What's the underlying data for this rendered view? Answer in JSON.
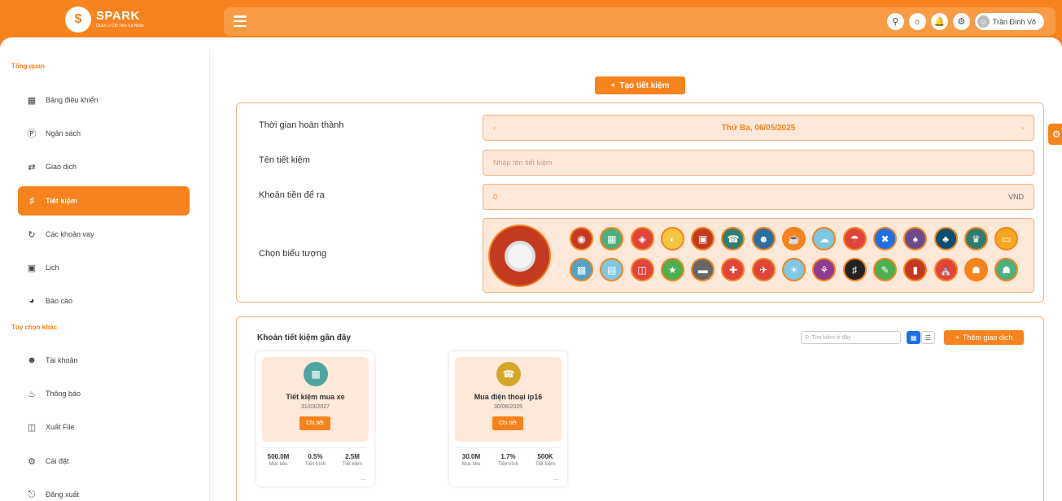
{
  "brand": {
    "name": "SPARK",
    "tagline": "Quản Lí Chi Tiêu Cá Nhân",
    "logo_symbol": "$"
  },
  "header": {
    "icons": [
      "search-icon",
      "sun-icon",
      "bell-icon",
      "settings-icon"
    ],
    "user_name": "Trần Đình Võ"
  },
  "sidebar": {
    "section_overview": "Tổng quan",
    "section_other": "Tùy chọn khác",
    "items": [
      {
        "label": "Bảng điều khiển",
        "icon": "dashboard-icon"
      },
      {
        "label": "Ngân sách",
        "icon": "dollar-icon"
      },
      {
        "label": "Giao dịch",
        "icon": "transfer-icon"
      },
      {
        "label": "Tiết kiệm",
        "icon": "piggy-icon"
      },
      {
        "label": "Các khoản vay",
        "icon": "loan-icon"
      },
      {
        "label": "Lịch",
        "icon": "calendar-icon"
      },
      {
        "label": "Báo cáo",
        "icon": "report-icon"
      }
    ],
    "other_items": [
      {
        "label": "Tài khoản",
        "icon": "user-icon"
      },
      {
        "label": "Thông báo",
        "icon": "bell-icon"
      },
      {
        "label": "Xuất File",
        "icon": "file-export-icon"
      },
      {
        "label": "Cài đặt",
        "icon": "gear-icon"
      },
      {
        "label": "Đăng xuất",
        "icon": "logout-icon"
      }
    ]
  },
  "main": {
    "create_button": "Tạo tiết kiệm",
    "form": {
      "completion_label": "Thời gian hoàn thành",
      "completion_value": "Thứ Ba, 06/05/2025",
      "name_label": "Tên tiết kiệm",
      "name_placeholder": "Nhập tên tiết kiệm",
      "amount_label": "Khoản tiền để ra",
      "amount_value": "0",
      "amount_unit": "VND",
      "icon_label": "Chọn biểu tượng",
      "icon_colors": [
        "#c43a20",
        "#4caf7d",
        "#e0443a",
        "#f5c542",
        "#c43a20",
        "#2e7d6e",
        "#2f6f9f",
        "#f7831e",
        "#7ec8e3",
        "#e0443a",
        "#1e6fe8",
        "#6a4a8c",
        "#0d4f6f",
        "#2e7d6e",
        "#f5a623",
        "#4fa3c7",
        "#7ec8e3",
        "#e0443a",
        "#4caf50",
        "#666666",
        "#e0443a",
        "#e0443a",
        "#7ec8e3",
        "#8e3d8e",
        "#222222",
        "#4caf50",
        "#c43a20",
        "#e0443a",
        "#f7831e",
        "#4caf7d"
      ]
    },
    "recent": {
      "title": "Khoản tiết kiệm gần đây",
      "search_placeholder": "Tìm kiếm ở đây",
      "add_button": "Thêm giao dịch",
      "cards": [
        {
          "name": "Tiết kiệm mua xe",
          "date": "31/03/2027",
          "detail": "Chi tiết",
          "icon": "car-icon",
          "icon_color": "#4fa3a0",
          "stats": [
            {
              "value": "500.0M",
              "label": "Mục tiêu"
            },
            {
              "value": "0.5%",
              "label": "Tiến trình"
            },
            {
              "value": "2.5M",
              "label": "Tiết kiệm"
            }
          ]
        },
        {
          "name": "Mua điện thoại ip16",
          "date": "30/06/2025",
          "detail": "Chi tiết",
          "icon": "phone-icon",
          "icon_color": "#d4a62a",
          "stats": [
            {
              "value": "30.0M",
              "label": "Mục tiêu"
            },
            {
              "value": "1.7%",
              "label": "Tiến trình"
            },
            {
              "value": "500K",
              "label": "Tiết kiệm"
            }
          ]
        }
      ]
    }
  }
}
